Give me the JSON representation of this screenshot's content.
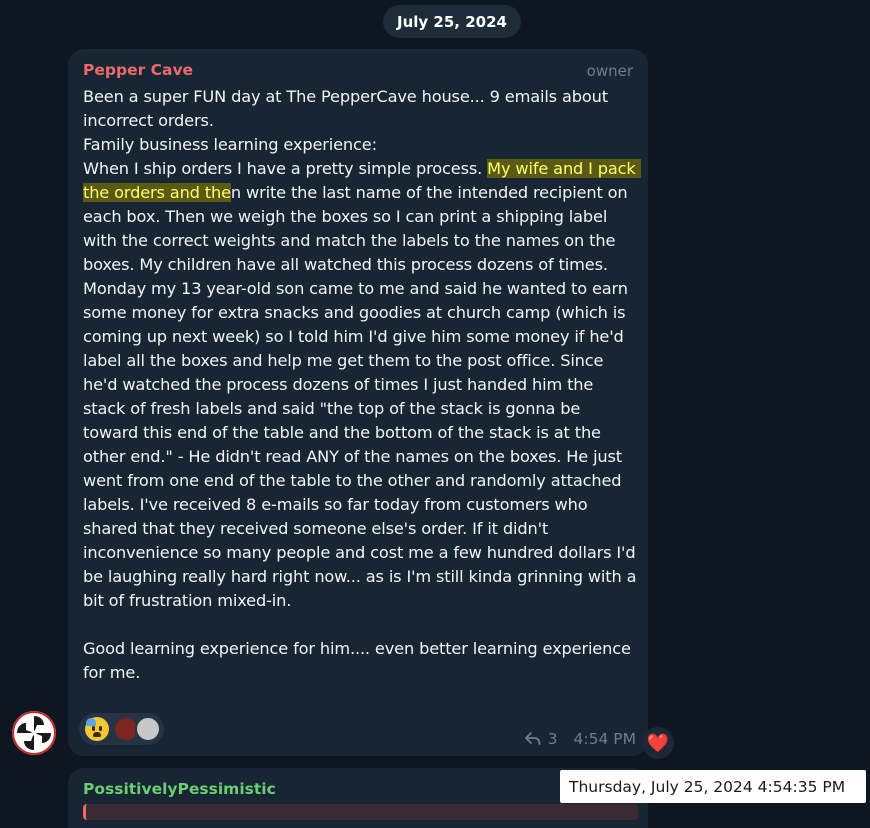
{
  "date_separator": "July 25, 2024",
  "message": {
    "sender": "Pepper Cave",
    "role": "owner",
    "text_before_highlight": "Been a super FUN day at The PepperCave house... 9 emails about incorrect orders.\nFamily business learning experience:\nWhen I ship orders I have a pretty simple process. ",
    "text_highlight": "My wife and I pack the orders and the",
    "text_after_highlight": "n write the last name of the intended recipient on each box. Then we weigh the boxes so I can print a shipping label with the correct weights and match the labels to the names on the boxes. My children have all watched this process dozens of times.\nMonday my 13 year-old son came to me and said he wanted to earn some money for extra snacks and goodies at church camp (which is coming up next week) so I told him I'd give him some money if he'd label all the boxes and help me get them to the post office. Since he'd watched the process dozens of times I just handed him the stack of fresh labels and said \"the top of the stack is gonna be toward this end of the table and the bottom of the stack is at the other end.\" - He didn't read ANY of the names on the boxes. He just went from one end of the table to the other and randomly attached labels. I've received 8 e-mails so far today from customers who shared that they received someone else's order. If it didn't inconvenience so many people and cost me a few hundred dollars I'd be laughing really hard right now... as is I'm still kinda grinning with a bit of frustration mixed-in.\n\nGood learning experience for him.... even better learning experience for me.",
    "reply_count": "3",
    "time": "4:54 PM",
    "reactions": [
      "anxious-face-with-sweat",
      "reactor-avatar",
      "reactor-avatar"
    ],
    "own_reaction": "❤️",
    "highlight_color": "#ffff6b"
  },
  "next_message": {
    "sender": "PossitivelyPessimistic"
  },
  "tooltip": "Thursday, July 25, 2024 4:54:35 PM",
  "colors": {
    "background": "#0e1621",
    "bubble": "#182533",
    "sender_owner": "#ee6a6a",
    "sender_next": "#6bce73",
    "meta": "#6d7f8f"
  }
}
